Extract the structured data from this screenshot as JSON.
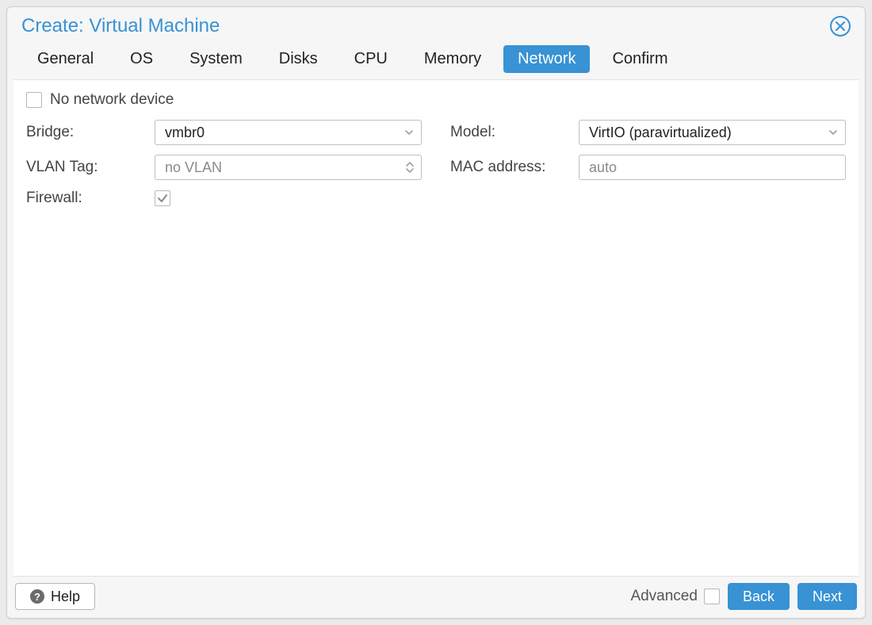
{
  "window": {
    "title": "Create: Virtual Machine"
  },
  "tabs": [
    {
      "label": "General",
      "active": false
    },
    {
      "label": "OS",
      "active": false
    },
    {
      "label": "System",
      "active": false
    },
    {
      "label": "Disks",
      "active": false
    },
    {
      "label": "CPU",
      "active": false
    },
    {
      "label": "Memory",
      "active": false
    },
    {
      "label": "Network",
      "active": true
    },
    {
      "label": "Confirm",
      "active": false
    }
  ],
  "form": {
    "no_network_label": "No network device",
    "no_network_checked": false,
    "bridge_label": "Bridge:",
    "bridge_value": "vmbr0",
    "vlan_label": "VLAN Tag:",
    "vlan_placeholder": "no VLAN",
    "vlan_value": "",
    "firewall_label": "Firewall:",
    "firewall_checked": true,
    "model_label": "Model:",
    "model_value": "VirtIO (paravirtualized)",
    "mac_label": "MAC address:",
    "mac_placeholder": "auto",
    "mac_value": ""
  },
  "footer": {
    "help_label": "Help",
    "advanced_label": "Advanced",
    "advanced_checked": false,
    "back_label": "Back",
    "next_label": "Next"
  }
}
